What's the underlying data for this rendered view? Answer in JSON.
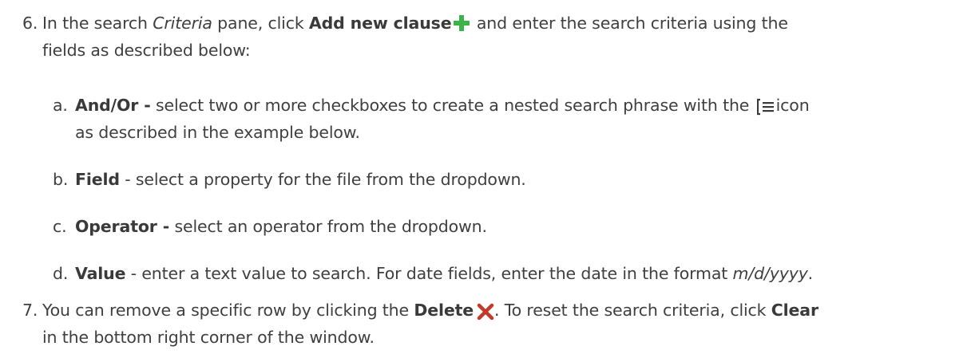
{
  "step6": {
    "num": "6.",
    "t1": "In the search ",
    "criteria": "Criteria",
    "t2": " pane, click ",
    "add_clause": "Add new clause",
    "t3": " and enter the search criteria using the",
    "t4": "fields as described below:"
  },
  "sub_a": {
    "letter": "a.",
    "term": "And/Or -",
    "t1": " select two or more checkboxes to create a nested search phrase with the ",
    "t2": "icon",
    "t3": "as described in the example below."
  },
  "sub_b": {
    "letter": "b.",
    "term": "Field",
    "t1": " - select a property for the file from the dropdown."
  },
  "sub_c": {
    "letter": "c.",
    "term": "Operator -",
    "t1": " select an operator from the dropdown."
  },
  "sub_d": {
    "letter": "d.",
    "term": "Value",
    "t1": " - enter a text value to search. For date fields, enter the date in the format ",
    "format": "m/d/yyyy",
    "t2": "."
  },
  "step7": {
    "num": "7.",
    "t1": "You can remove a specific row by clicking the ",
    "delete": "Delete",
    "t2": ". To reset the search criteria, click ",
    "clear": "Clear",
    "t3": "in the bottom right corner of the window."
  },
  "icons": {
    "add": "plus-icon",
    "nest": "nest-icon",
    "delete": "x-icon"
  },
  "colors": {
    "text": "#3f3f3f",
    "add_icon": "#3cb44a",
    "delete_icon": "#c0392b"
  }
}
